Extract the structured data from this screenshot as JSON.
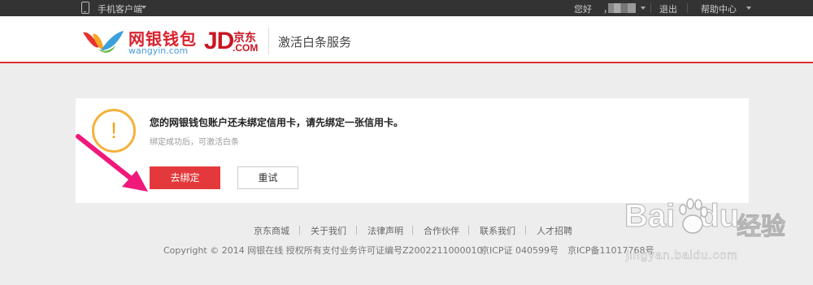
{
  "topbar": {
    "mobile_client": "手机客户端",
    "greeting": "您好",
    "greeting_comma": "，",
    "logout": "退出",
    "help_center": "帮助中心"
  },
  "header": {
    "logo_cn": "网银钱包",
    "logo_en": "wangyin.com",
    "jd_mark": "JD",
    "jd_cn": "京东",
    "jd_com": ".COM",
    "page_title": "激活白条服务"
  },
  "notice": {
    "icon": "warning-icon",
    "icon_glyph": "!",
    "message": "您的网银钱包账户还未绑定信用卡，请先绑定一张信用卡。",
    "sub_message": "绑定成功后，可激活白条",
    "primary_button": "去绑定",
    "secondary_button": "重试"
  },
  "footer": {
    "links": [
      "京东商城",
      "关于我们",
      "法律声明",
      "合作伙伴",
      "联系我们",
      "人才招聘"
    ],
    "copyright": "Copyright © 2014 网银在线 授权所有",
    "license": "支付业务许可证编号Z2002211000010",
    "icp1": "京ICP证 040599号",
    "icp2": "京ICP备11017768号"
  },
  "watermark": {
    "brand": "Bai",
    "brand_tail": "du",
    "cn": "经验",
    "url": "jingyan.baidu.com"
  },
  "colors": {
    "accent_red": "#e4393c",
    "warning_orange": "#f5b13c",
    "topbar_bg": "#333333",
    "arrow_pink": "#f0187a"
  }
}
